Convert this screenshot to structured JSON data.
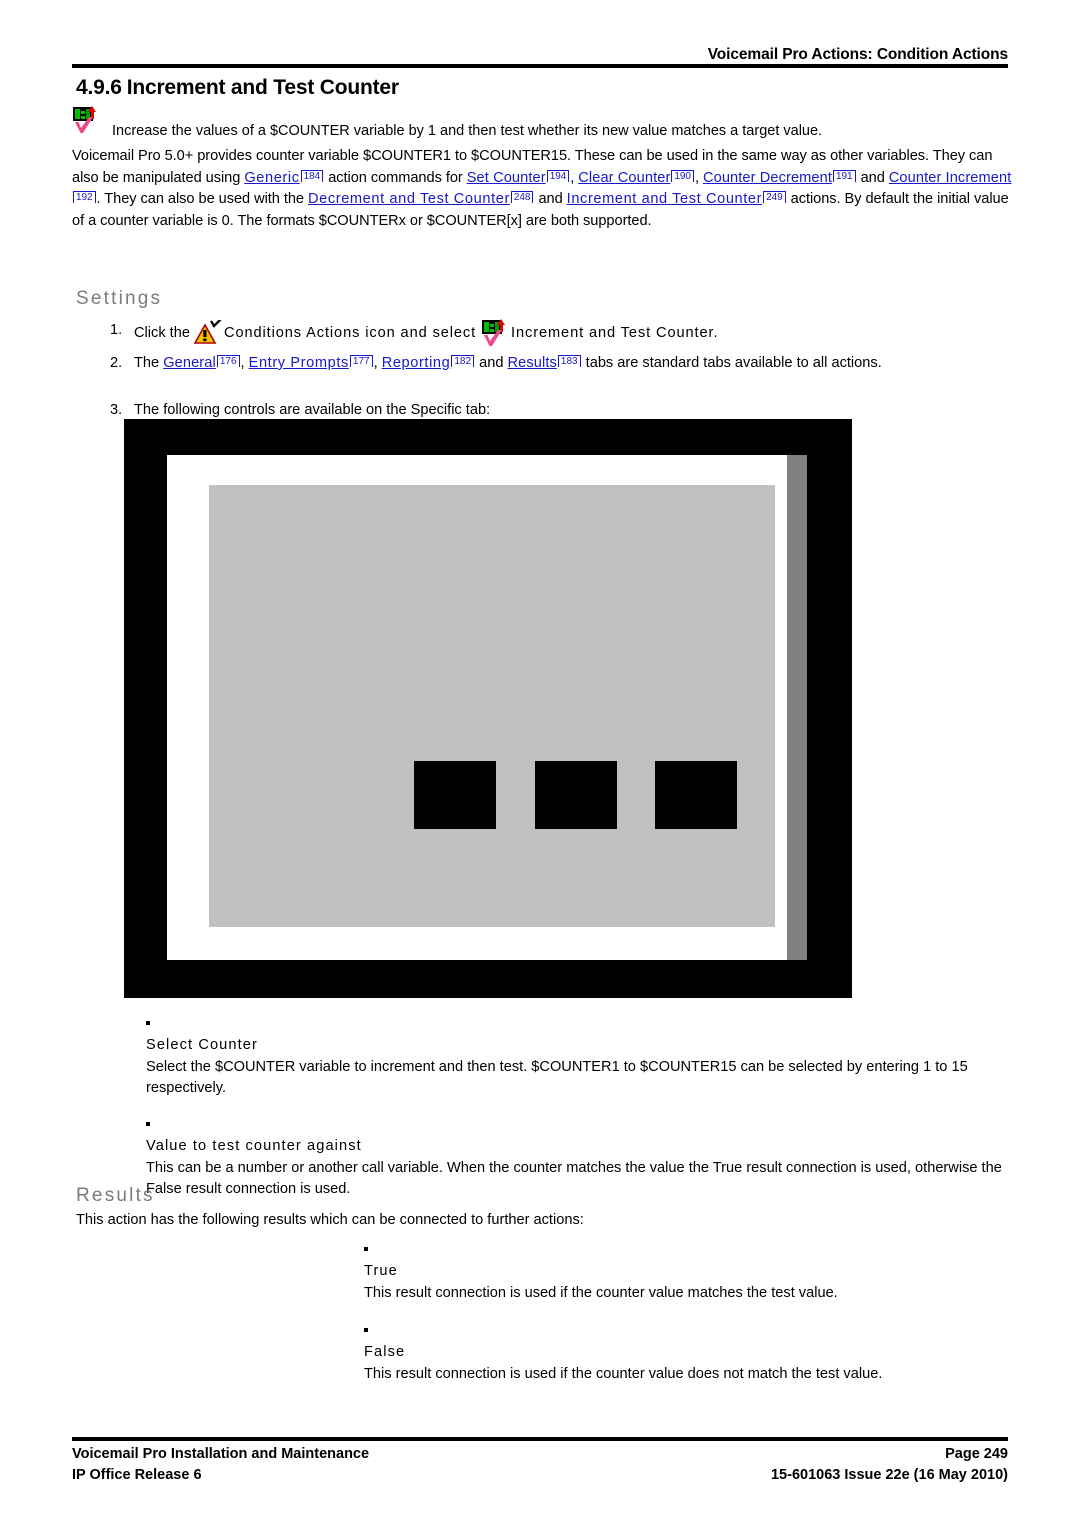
{
  "header": {
    "title": "Voicemail Pro Actions: Condition Actions"
  },
  "section": {
    "number": "4.9.6",
    "title": "Increment and Test Counter"
  },
  "intro": {
    "icon": "increment-and-test-counter-icon",
    "text": "Increase the values of a $COUNTER variable by 1 and then test whether its new value matches a target value."
  },
  "body": {
    "p1_a": "Voicemail Pro 5.0+ provides counter variable $COUNTER1 to $COUNTER15. These can be used in the same way as other variables. They can also be manipulated using ",
    "link_generic": "Generic",
    "ref_generic": "184",
    "p1_b": " action commands for ",
    "link_set_counter": "Set Counter",
    "ref_set_counter": "194",
    "p1_c": ", ",
    "link_clear_counter": "Clear Counter",
    "ref_clear_counter": "190",
    "p1_d": ", ",
    "link_counter_decrement": "Counter Decrement",
    "ref_counter_decrement": "191",
    "p1_e": " and ",
    "link_counter_increment": "Counter Increment",
    "ref_counter_increment": "192",
    "p1_f": ". They can also be used with the ",
    "link_decrement_and_test": "Decrement and Test Counter",
    "ref_decrement_and_test": "248",
    "p1_g": " and ",
    "link_increment_and_test": "Increment and Test Counter",
    "ref_increment_and_test": "249",
    "p1_h": " actions. By default the initial value of a counter variable is 0.  The formats $COUNTERx or $COUNTER[x] are both supported."
  },
  "settings": {
    "heading": "Settings",
    "items": [
      {
        "marker": "1.",
        "text_a": "Click the ",
        "icon_conditions": "conditions-actions-icon",
        "text_b": "Conditions Actions icon and select ",
        "icon_action": "increment-and-test-counter-icon",
        "text_c": "Increment and Test Counter."
      },
      {
        "marker": "2.",
        "text_a": "The ",
        "link_general": "General",
        "ref_general": "176",
        "text_b": ", ",
        "link_entry_prompts": "Entry Prompts",
        "ref_entry_prompts": "177",
        "text_c": ", ",
        "link_reporting": "Reporting",
        "ref_reporting": "182",
        "text_d": " and ",
        "link_results": "Results",
        "ref_results": "183",
        "text_e": " tabs are standard tabs available to all actions."
      },
      {
        "marker": "3.",
        "text_a": "The following controls are available on the Specific tab:"
      }
    ]
  },
  "screenshot": {
    "alt": "Increment and Test Counter specific tab dialog"
  },
  "specific_controls": [
    {
      "term": "Select Counter",
      "desc": "Select the $COUNTER variable to increment and then test. $COUNTER1 to $COUNTER15 can be selected by entering 1 to 15 respectively."
    },
    {
      "term": "Value to test counter against",
      "desc": "This can be a number or another call variable. When the counter matches the value the True result connection is used, otherwise the False result connection is used."
    }
  ],
  "results": {
    "heading": "Results",
    "intro": "This action has the following results which can be connected to further actions:",
    "items": [
      {
        "term": "True",
        "desc": "This result connection is used if the counter value matches the test value."
      },
      {
        "term": "False",
        "desc": "This result connection is used if the counter value does not match the test value."
      }
    ]
  },
  "footer": {
    "left_line1": "Voicemail Pro Installation and Maintenance",
    "left_line2": "IP Office Release 6",
    "right_line1": "Page 249",
    "right_line2": "15-601063 Issue 22e (16 May 2010)"
  },
  "colors": {
    "link": "#1818c8",
    "subheading": "#7b7b7b",
    "panel": "#c0c0c0",
    "shadow": "#808080"
  }
}
